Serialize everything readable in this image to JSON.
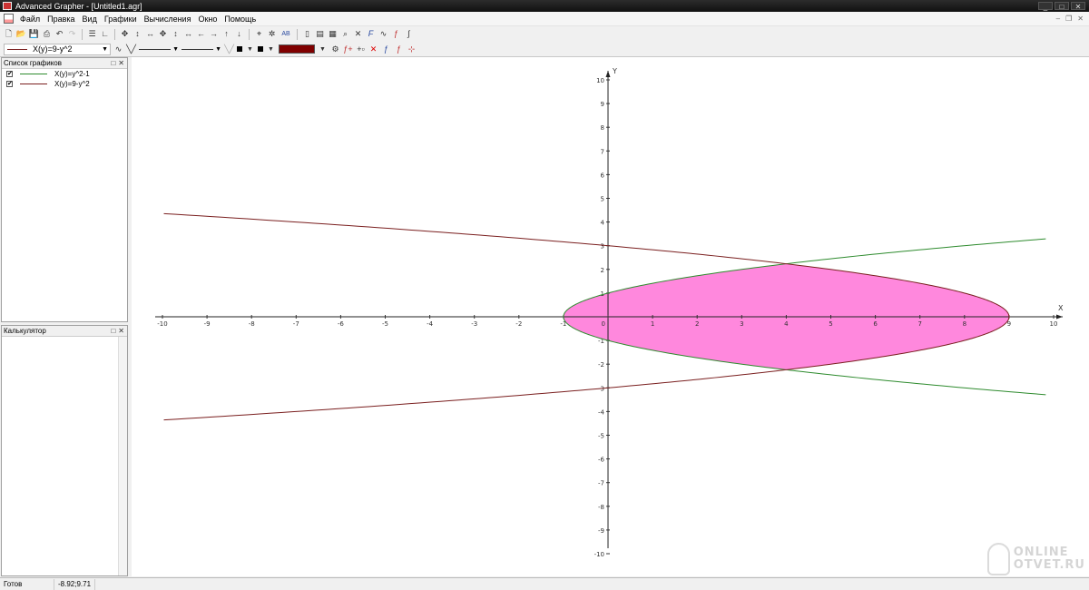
{
  "window": {
    "title": "Advanced Grapher - [Untitled1.agr]",
    "controls": {
      "minimize": "_",
      "maximize": "□",
      "close": "✕"
    }
  },
  "menu": {
    "items": [
      "Файл",
      "Правка",
      "Вид",
      "Графики",
      "Вычисления",
      "Окно",
      "Помощь"
    ],
    "mdi_controls": {
      "minimize": "–",
      "restore": "❐",
      "close": "✕"
    }
  },
  "toolbar2": {
    "function_selector": "X(y)=9-y^2",
    "line_color": "#800000",
    "ab_label": "AB"
  },
  "graph_list_panel": {
    "title": "Список графиков",
    "items": [
      {
        "label": "X(y)=y^2-1",
        "color": "#2e8b2e",
        "checked": "✔"
      },
      {
        "label": "X(y)=9-y^2",
        "color": "#7a1f1f",
        "checked": "✔"
      }
    ]
  },
  "calculator_panel": {
    "title": "Калькулятор"
  },
  "panel_buttons": {
    "float": "□",
    "close": "✕"
  },
  "chart_data": {
    "type": "line",
    "xlabel": "X",
    "ylabel": "Y",
    "xlim": [
      -10,
      10
    ],
    "ylim": [
      -10,
      10
    ],
    "x_ticks": [
      -10,
      -9,
      -8,
      -7,
      -6,
      -5,
      -4,
      -3,
      -2,
      -1,
      0,
      1,
      2,
      3,
      4,
      5,
      6,
      7,
      8,
      9,
      10
    ],
    "y_ticks": [
      -10,
      -9,
      -8,
      -7,
      -6,
      -5,
      -4,
      -3,
      -2,
      -1,
      1,
      2,
      3,
      4,
      5,
      6,
      7,
      8,
      9,
      10
    ],
    "origin_label": "0",
    "series": [
      {
        "name": "X(y)=y^2-1",
        "color": "#2e8b2e",
        "points": [
          [
            10,
            3.32
          ],
          [
            8,
            3.0
          ],
          [
            4,
            2.24
          ],
          [
            0,
            1.0
          ],
          [
            -1,
            0
          ],
          [
            0,
            -1.0
          ],
          [
            4,
            -2.24
          ],
          [
            8,
            -3.0
          ],
          [
            10,
            -3.32
          ]
        ]
      },
      {
        "name": "X(y)=9-y^2",
        "color": "#7a1f1f",
        "points": [
          [
            -10,
            4.36
          ],
          [
            -5,
            3.74
          ],
          [
            0,
            3.0
          ],
          [
            4,
            2.24
          ],
          [
            9,
            0
          ],
          [
            4,
            -2.24
          ],
          [
            0,
            -3.0
          ],
          [
            -5,
            -3.74
          ],
          [
            -10,
            -4.36
          ]
        ]
      }
    ],
    "shaded_region": {
      "between": [
        "X(y)=y^2-1",
        "X(y)=9-y^2"
      ],
      "y_range": [
        -2.236,
        2.236
      ],
      "color": "#ff88dd"
    },
    "grid": false
  },
  "status": {
    "state": "Готов",
    "coordinates": "-8.92;9.71"
  },
  "watermark": {
    "line1": "ONLINE",
    "line2": "OTVET.RU"
  }
}
